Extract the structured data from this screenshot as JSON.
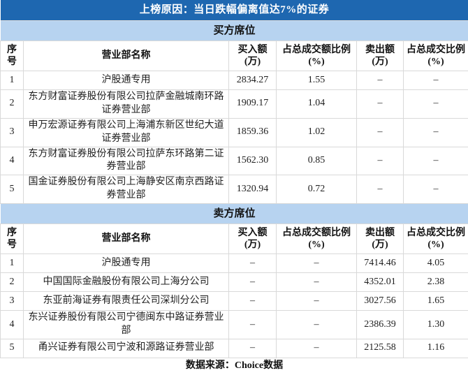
{
  "title": "上榜原因：当日跌幅偏离值达7%的证券",
  "colors": {
    "title_bg": "#1e67b0",
    "title_text": "#ffffff",
    "section_band_bg": "#b7d3f0",
    "grid_border": "#d9d9d9",
    "body_text": "#1f1f1f"
  },
  "buyer": {
    "section_title": "买方席位",
    "headers": [
      "序号",
      "营业部名称",
      "买入额(万)",
      "占总成交额比例(%)",
      "卖出额(万)",
      "占总成交比例(%)"
    ],
    "rows": [
      {
        "seq": "1",
        "name": "沪股通专用",
        "buy": "2834.27",
        "buy_ratio": "1.55",
        "sell": "–",
        "sell_ratio": "–"
      },
      {
        "seq": "2",
        "name": "东方财富证券股份有限公司拉萨金融城南环路证券营业部",
        "buy": "1909.17",
        "buy_ratio": "1.04",
        "sell": "–",
        "sell_ratio": "–"
      },
      {
        "seq": "3",
        "name": "申万宏源证券有限公司上海浦东新区世纪大道证券营业部",
        "buy": "1859.36",
        "buy_ratio": "1.02",
        "sell": "–",
        "sell_ratio": "–"
      },
      {
        "seq": "4",
        "name": "东方财富证券股份有限公司拉萨东环路第二证券营业部",
        "buy": "1562.30",
        "buy_ratio": "0.85",
        "sell": "–",
        "sell_ratio": "–"
      },
      {
        "seq": "5",
        "name": "国金证券股份有限公司上海静安区南京西路证券营业部",
        "buy": "1320.94",
        "buy_ratio": "0.72",
        "sell": "–",
        "sell_ratio": "–"
      }
    ]
  },
  "seller": {
    "section_title": "卖方席位",
    "headers": [
      "序号",
      "营业部名称",
      "买入额(万)",
      "占总成交额比例(%)",
      "卖出额(万)",
      "占总成交比例(%)"
    ],
    "rows": [
      {
        "seq": "1",
        "name": "沪股通专用",
        "buy": "–",
        "buy_ratio": "–",
        "sell": "7414.46",
        "sell_ratio": "4.05"
      },
      {
        "seq": "2",
        "name": "中国国际金融股份有限公司上海分公司",
        "buy": "–",
        "buy_ratio": "–",
        "sell": "4352.01",
        "sell_ratio": "2.38"
      },
      {
        "seq": "3",
        "name": "东亚前海证券有限责任公司深圳分公司",
        "buy": "–",
        "buy_ratio": "–",
        "sell": "3027.56",
        "sell_ratio": "1.65"
      },
      {
        "seq": "4",
        "name": "东兴证券股份有限公司宁德闽东中路证券营业部",
        "buy": "–",
        "buy_ratio": "–",
        "sell": "2386.39",
        "sell_ratio": "1.30"
      },
      {
        "seq": "5",
        "name": "甬兴证券有限公司宁波和源路证券营业部",
        "buy": "–",
        "buy_ratio": "–",
        "sell": "2125.58",
        "sell_ratio": "1.16"
      }
    ]
  },
  "footer": {
    "source": "数据来源：Choice数据"
  }
}
